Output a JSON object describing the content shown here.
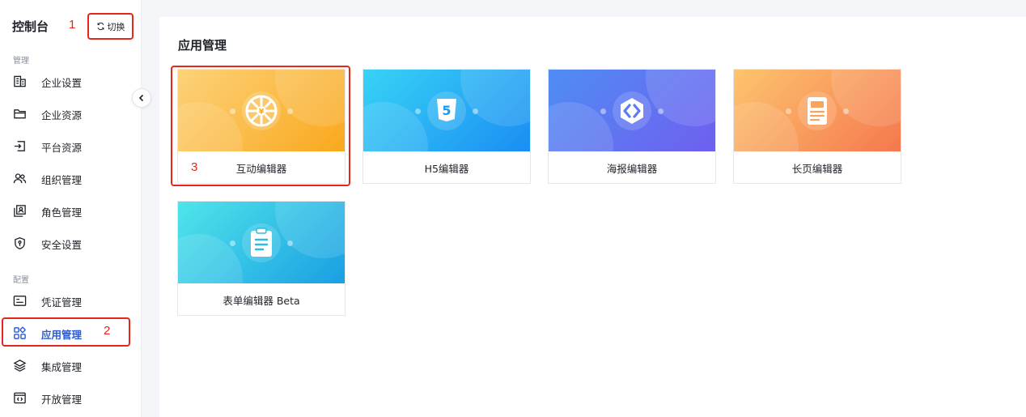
{
  "sidebar": {
    "title": "控制台",
    "switch_label": "切换",
    "sections": [
      {
        "label": "管理"
      },
      {
        "label": "配置"
      }
    ],
    "items": [
      {
        "label": "企业设置",
        "icon": "building-icon"
      },
      {
        "label": "企业资源",
        "icon": "folder-icon"
      },
      {
        "label": "平台资源",
        "icon": "import-icon"
      },
      {
        "label": "组织管理",
        "icon": "users-icon"
      },
      {
        "label": "角色管理",
        "icon": "role-icon"
      },
      {
        "label": "安全设置",
        "icon": "shield-icon"
      },
      {
        "label": "凭证管理",
        "icon": "credential-icon"
      },
      {
        "label": "应用管理",
        "icon": "apps-grid-icon",
        "active": true
      },
      {
        "label": "集成管理",
        "icon": "layers-icon"
      },
      {
        "label": "开放管理",
        "icon": "code-window-icon"
      }
    ]
  },
  "annotations": {
    "step1": "1",
    "step2": "2",
    "step3": "3"
  },
  "main": {
    "title": "应用管理",
    "cards": [
      {
        "name": "互动编辑器",
        "icon": "wheel-icon",
        "gradient": [
          "#fdd27a",
          "#f9a81d"
        ]
      },
      {
        "name": "H5编辑器",
        "icon": "html5-icon",
        "gradient": [
          "#38d3f5",
          "#1a8df3"
        ]
      },
      {
        "name": "海报编辑器",
        "icon": "hexagon-link-icon",
        "gradient": [
          "#4f8df3",
          "#6f5ff0"
        ]
      },
      {
        "name": "长页编辑器",
        "icon": "long-page-icon",
        "gradient": [
          "#fdc56e",
          "#f5784e"
        ]
      },
      {
        "name": "表单编辑器 Beta",
        "icon": "clipboard-form-icon",
        "gradient": [
          "#4fe5ea",
          "#1a9fe3"
        ]
      }
    ]
  },
  "colors": {
    "accent": "#2a5bd7",
    "annotation_red": "#e5261b"
  }
}
